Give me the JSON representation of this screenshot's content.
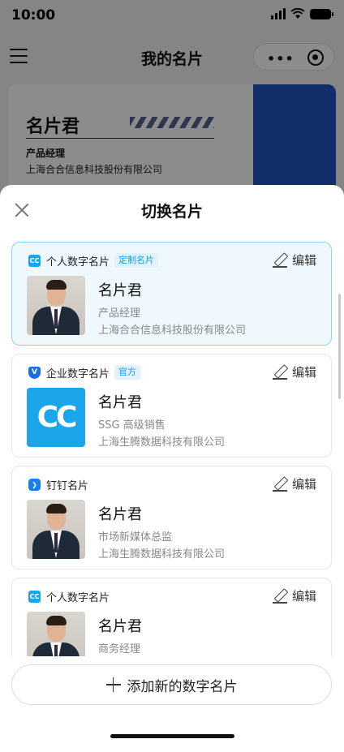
{
  "status_bar": {
    "time": "10:00"
  },
  "navbar": {
    "title": "我的名片",
    "more_glyph": "•••"
  },
  "background_card": {
    "name": "名片君",
    "title": "产品经理",
    "company": "上海合合信息科技股份有限公司"
  },
  "sheet": {
    "title": "切换名片",
    "edit_label": "编辑",
    "cards": [
      {
        "type_label": "个人数字名片",
        "badge": "定制名片",
        "icon": "cc-icon",
        "name": "名片君",
        "title": "产品经理",
        "company": "上海合合信息科技股份有限公司",
        "selected": true,
        "avatar": "photo"
      },
      {
        "type_label": "企业数字名片",
        "badge": "官方",
        "icon": "shield-v-icon",
        "name": "名片君",
        "title": "SSG 高级销售",
        "company": "上海生腾数据科技有限公司",
        "selected": false,
        "avatar": "cc-logo"
      },
      {
        "type_label": "钉钉名片",
        "badge": "",
        "icon": "dingtalk-icon",
        "name": "名片君",
        "title": "市场新媒体总监",
        "company": "上海生腾数据科技有限公司",
        "selected": false,
        "avatar": "photo"
      },
      {
        "type_label": "个人数字名片",
        "badge": "",
        "icon": "cc-icon",
        "name": "名片君",
        "title": "商务经理",
        "company": "",
        "selected": false,
        "avatar": "photo"
      }
    ],
    "add_button_label": "添加新的数字名片"
  },
  "icon_glyphs": {
    "cc": "CC",
    "shield": "V",
    "ding": "❯"
  },
  "colors": {
    "accent": "#1ba6e8",
    "selected_border": "#8ed4ef",
    "selected_bg": "#eef8fd"
  }
}
